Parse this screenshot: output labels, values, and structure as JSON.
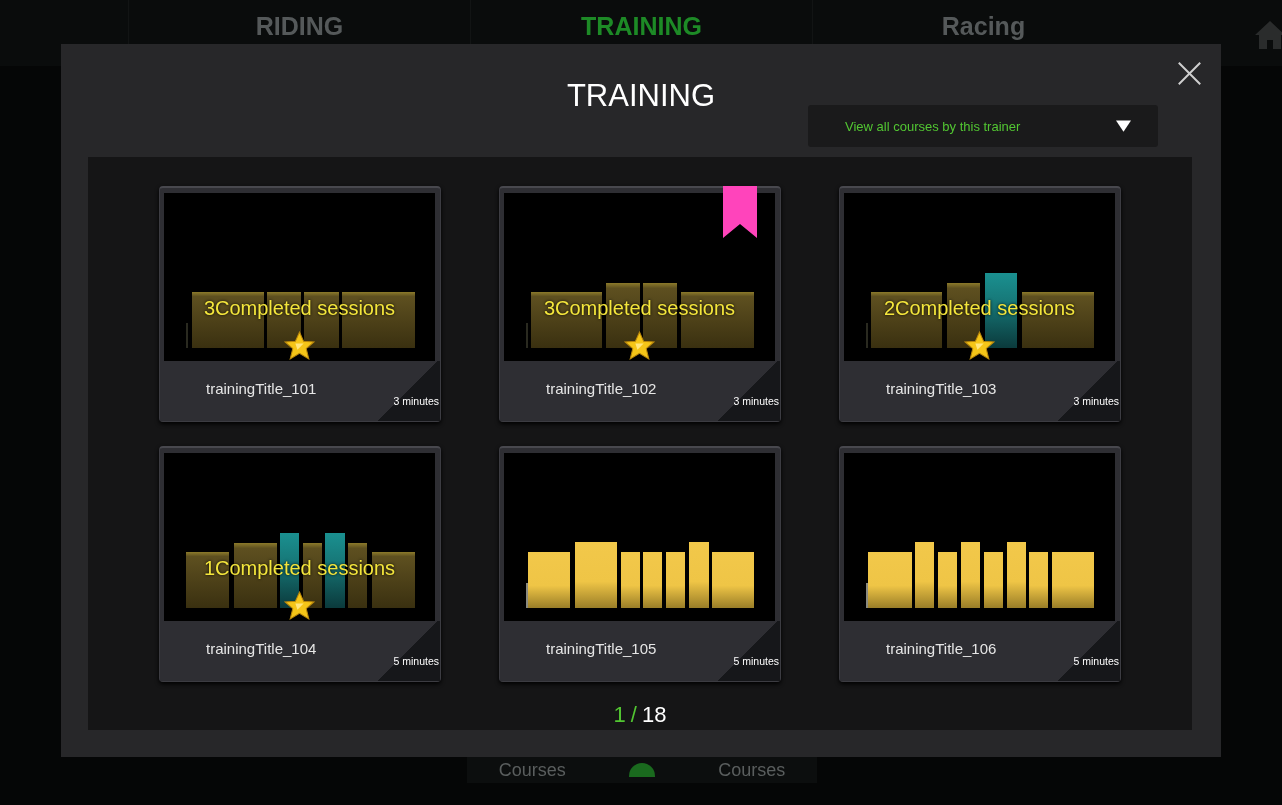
{
  "background": {
    "tabs": [
      {
        "label": "RIDING",
        "selected": false
      },
      {
        "label": "TRAINING",
        "selected": true
      },
      {
        "label": "Racing",
        "selected": false
      }
    ],
    "bottom_labels": [
      "Courses",
      "Courses"
    ],
    "toggle_on": true
  },
  "dialog": {
    "title": "TRAINING",
    "filter": "View all courses by this trainer"
  },
  "cards": [
    {
      "title": "trainingTitle_101",
      "duration": "3 minutes",
      "completed": true,
      "sessions": "3Completed sessions",
      "bookmarked": false
    },
    {
      "title": "trainingTitle_102",
      "duration": "3 minutes",
      "completed": true,
      "sessions": "3Completed sessions",
      "bookmarked": true
    },
    {
      "title": "trainingTitle_103",
      "duration": "3 minutes",
      "completed": true,
      "sessions": "2Completed sessions",
      "bookmarked": false
    },
    {
      "title": "trainingTitle_104",
      "duration": "5 minutes",
      "completed": true,
      "sessions": "1Completed sessions",
      "bookmarked": false
    },
    {
      "title": "trainingTitle_105",
      "duration": "5 minutes",
      "completed": false,
      "bookmarked": false
    },
    {
      "title": "trainingTitle_106",
      "duration": "5 minutes",
      "completed": false,
      "bookmarked": false
    }
  ],
  "pager": {
    "current": "1",
    "separator": "/",
    "total": "18"
  }
}
